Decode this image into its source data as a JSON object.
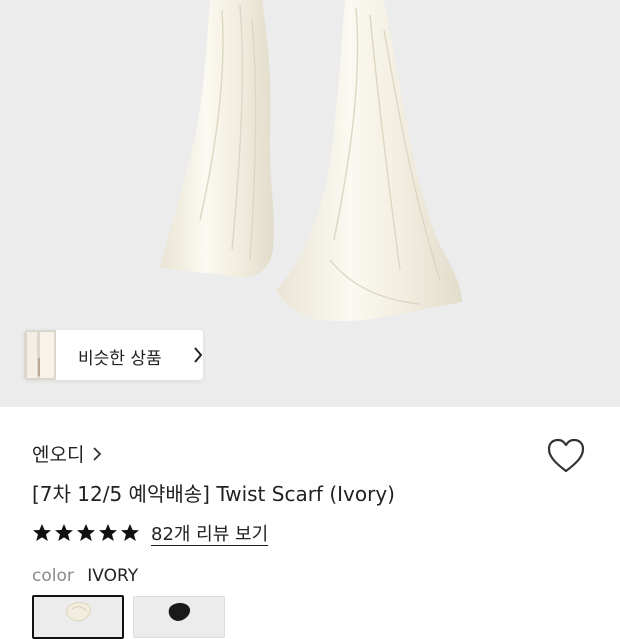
{
  "hero": {
    "similar_label": "비슷한 상품"
  },
  "product": {
    "brand": "엔오디",
    "title": "[7차 12/5 예약배송] Twist Scarf (Ivory)",
    "rating_stars": 5,
    "reviews_label": "82개 리뷰 보기",
    "color_label": "color",
    "color_value": "IVORY"
  },
  "swatches": [
    {
      "name": "ivory",
      "selected": true
    },
    {
      "name": "black",
      "selected": false
    }
  ],
  "colors": {
    "background": "#ececec",
    "scarf": "#f7f4ea",
    "star": "#111111"
  },
  "icons": [
    "chevron-right-icon",
    "heart-icon",
    "star-icon"
  ]
}
